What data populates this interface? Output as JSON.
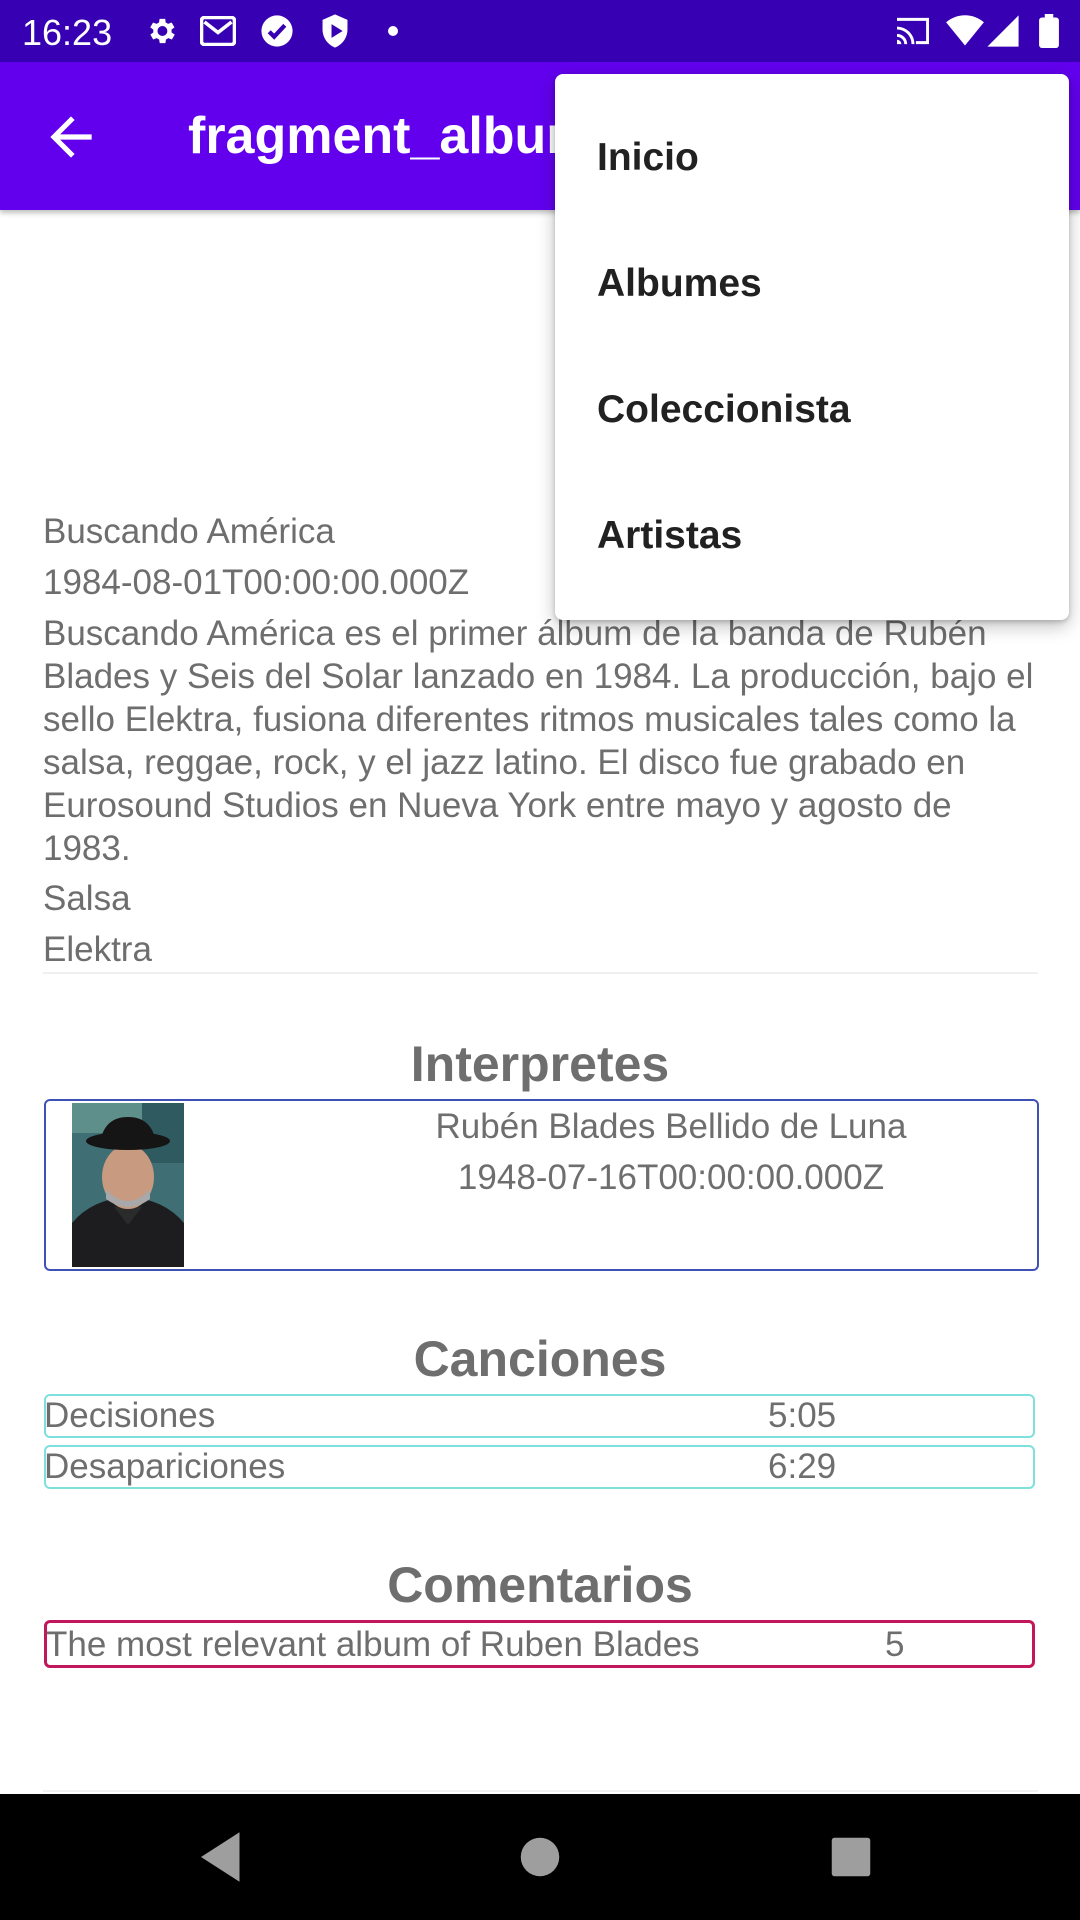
{
  "status_bar": {
    "time": "16:23",
    "left_icons": [
      "gear-icon",
      "gmail-icon",
      "check-circle-icon",
      "shield-play-icon",
      "dot-icon"
    ],
    "right_icons": [
      "cast-icon",
      "wifi-icon",
      "signal-icon",
      "battery-icon"
    ]
  },
  "app_bar": {
    "back_icon": "arrow-left-icon",
    "title": "fragment_album"
  },
  "menu": {
    "items": [
      "Inicio",
      "Albumes",
      "Coleccionista",
      "Artistas"
    ]
  },
  "album": {
    "name": "Buscando América",
    "release_date": "1984-08-01T00:00:00.000Z",
    "description": "Buscando América es el primer álbum de la banda de Rubén Blades y Seis del Solar lanzado en 1984. La producción, bajo el sello Elektra, fusiona diferentes ritmos musicales tales como la salsa, reggae, rock, y el jazz latino. El disco fue grabado en Eurosound Studios en Nueva York entre mayo y agosto de 1983.",
    "genre": "Salsa",
    "record_label": "Elektra"
  },
  "performers": {
    "title": "Interpretes",
    "items": [
      {
        "name": "Rubén Blades Bellido de Luna",
        "birth_date": "1948-07-16T00:00:00.000Z"
      }
    ]
  },
  "tracks": {
    "title": "Canciones",
    "items": [
      {
        "name": "Decisiones",
        "duration": "5:05"
      },
      {
        "name": "Desapariciones",
        "duration": "6:29"
      }
    ]
  },
  "comments": {
    "title": "Comentarios",
    "items": [
      {
        "text": "The most relevant album of Ruben Blades",
        "rating": "5"
      }
    ]
  },
  "colors": {
    "status_bar": "#3700b3",
    "app_bar": "#6200ee",
    "performer_border": "#3f51b5",
    "track_border": "#7de0dc",
    "comment_border": "#c2185b"
  }
}
